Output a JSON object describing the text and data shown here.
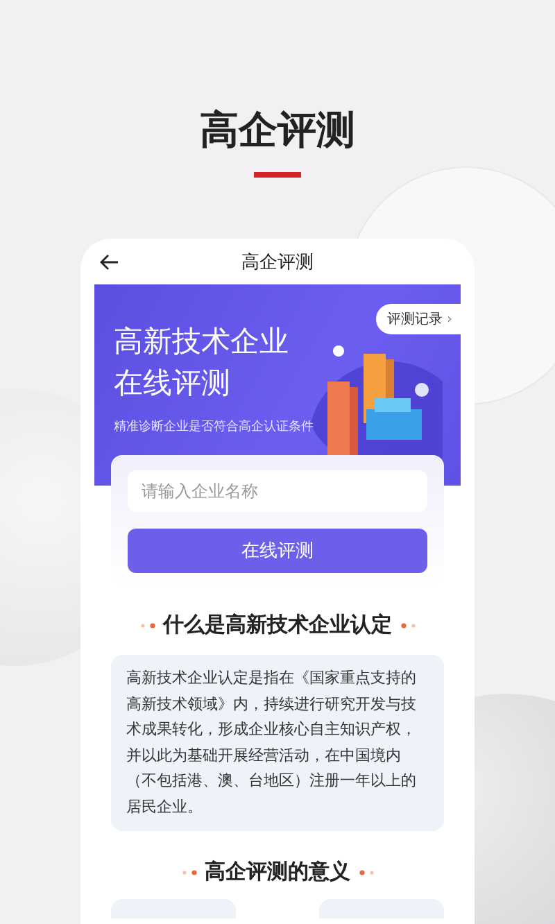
{
  "page_title": "高企评测",
  "screen": {
    "nav": {
      "title": "高企评测"
    },
    "banner": {
      "title_lines": [
        "高新技术企业",
        "在线评测"
      ],
      "subtitle": "精准诊断企业是否符合高企认证条件",
      "record_button": {
        "label": "评测记录",
        "arrow": "›"
      }
    },
    "form": {
      "company_field": {
        "placeholder": "请输入企业名称"
      },
      "submit_button": "在线评测"
    },
    "sections": [
      {
        "heading": "什么是高新技术企业认定",
        "body": "高新技术企业认定是指在《国家重点支持的高新技术领域》内，持续进行研究开发与技术成果转化，形成企业核心自主知识产权，并以此为基础开展经营活动，在中国境内（不包括港、澳、台地区）注册一年以上的居民企业。"
      },
      {
        "heading": "高企评测的意义"
      }
    ]
  }
}
